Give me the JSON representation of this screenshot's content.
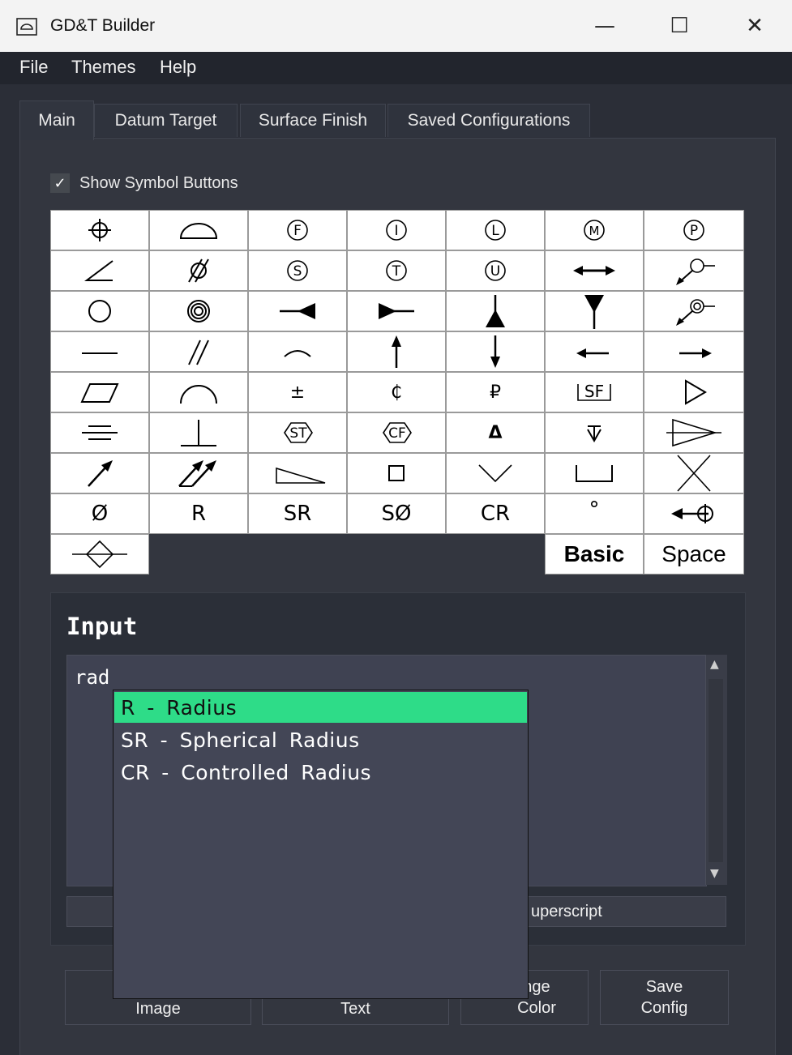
{
  "window": {
    "title": "GD&T Builder",
    "minimize": "—",
    "maximize": "☐",
    "close": "✕"
  },
  "menu": [
    "File",
    "Themes",
    "Help"
  ],
  "tabs": [
    {
      "label": "Main",
      "active": true
    },
    {
      "label": "Datum Target",
      "active": false
    },
    {
      "label": "Surface Finish",
      "active": false
    },
    {
      "label": "Saved Configurations",
      "active": false
    }
  ],
  "show_symbols": {
    "checked": true,
    "check_mark": "✓",
    "label": "Show Symbol Buttons"
  },
  "symbols": {
    "text_cells": {
      "plus_minus": "±",
      "centerline": "₵",
      "ruble": "₽",
      "sf": "SF",
      "st": "ST",
      "cf": "CF",
      "delta": "Δ",
      "diameter": "Ø",
      "radius": "R",
      "spherical_radius": "SR",
      "spherical_diameter": "SØ",
      "controlled_radius": "CR",
      "degree": "°",
      "basic": "Basic",
      "space": "Space",
      "circle_f": "F",
      "circle_i": "I",
      "circle_l": "L",
      "circle_m": "M",
      "circle_p": "P",
      "circle_s": "S",
      "circle_t": "T",
      "circle_u": "U"
    }
  },
  "input": {
    "title": "Input",
    "value": "rad",
    "superscript_label": "uperscript"
  },
  "autocomplete": [
    {
      "label": "R - Radius",
      "selected": true
    },
    {
      "label": "SR - Spherical Radius",
      "selected": false
    },
    {
      "label": "CR - Controlled Radius",
      "selected": false
    }
  ],
  "buttons": {
    "image_label": "Image",
    "text_label": "Text",
    "color_top": "nge",
    "color_bottom": "Color",
    "save_top": "Save",
    "save_bottom": "Config"
  },
  "colors": {
    "accent": "#2edc88",
    "background": "#2b2e37"
  }
}
